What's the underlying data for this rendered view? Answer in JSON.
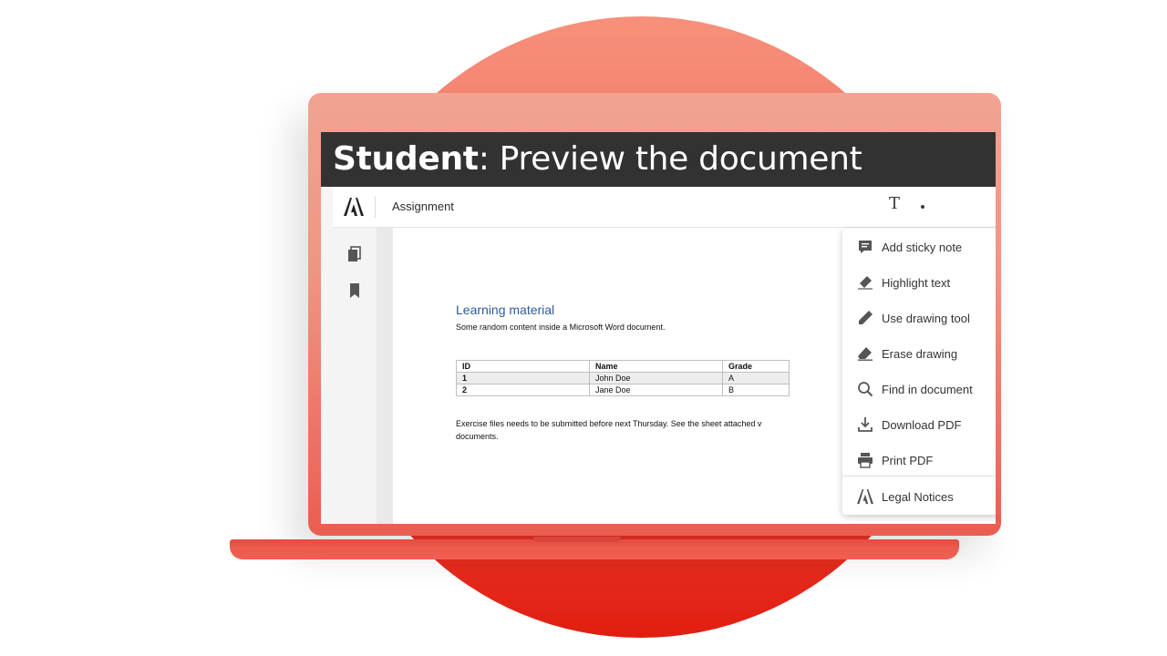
{
  "banner": {
    "title_bold": "Student",
    "title_rest": ": Preview the document"
  },
  "toolbar": {
    "title": "Assignment",
    "text_tool": "T"
  },
  "document": {
    "heading": "Learning material",
    "subtext": "Some random content inside a Microsoft Word document.",
    "table": {
      "headers": [
        "ID",
        "Name",
        "Grade"
      ],
      "rows": [
        [
          "1",
          "John Doe",
          "A"
        ],
        [
          "2",
          "Jane Doe",
          "B"
        ]
      ]
    },
    "note": "Exercise files needs to be submitted before next Thursday. See the sheet attached v documents."
  },
  "menu": {
    "items": [
      {
        "label": "Add sticky note",
        "icon": "sticky-note-icon"
      },
      {
        "label": "Highlight text",
        "icon": "highlighter-icon"
      },
      {
        "label": "Use drawing tool",
        "icon": "pencil-icon"
      },
      {
        "label": "Erase drawing",
        "icon": "eraser-icon"
      },
      {
        "label": "Find in document",
        "icon": "search-icon"
      },
      {
        "label": "Download PDF",
        "icon": "download-icon"
      },
      {
        "label": "Print PDF",
        "icon": "print-icon"
      },
      {
        "label": "Legal Notices",
        "icon": "adobe-logo-icon"
      }
    ]
  },
  "colors": {
    "accent": "#e01e10",
    "banner": "#323232",
    "heading": "#2e5b9a"
  }
}
